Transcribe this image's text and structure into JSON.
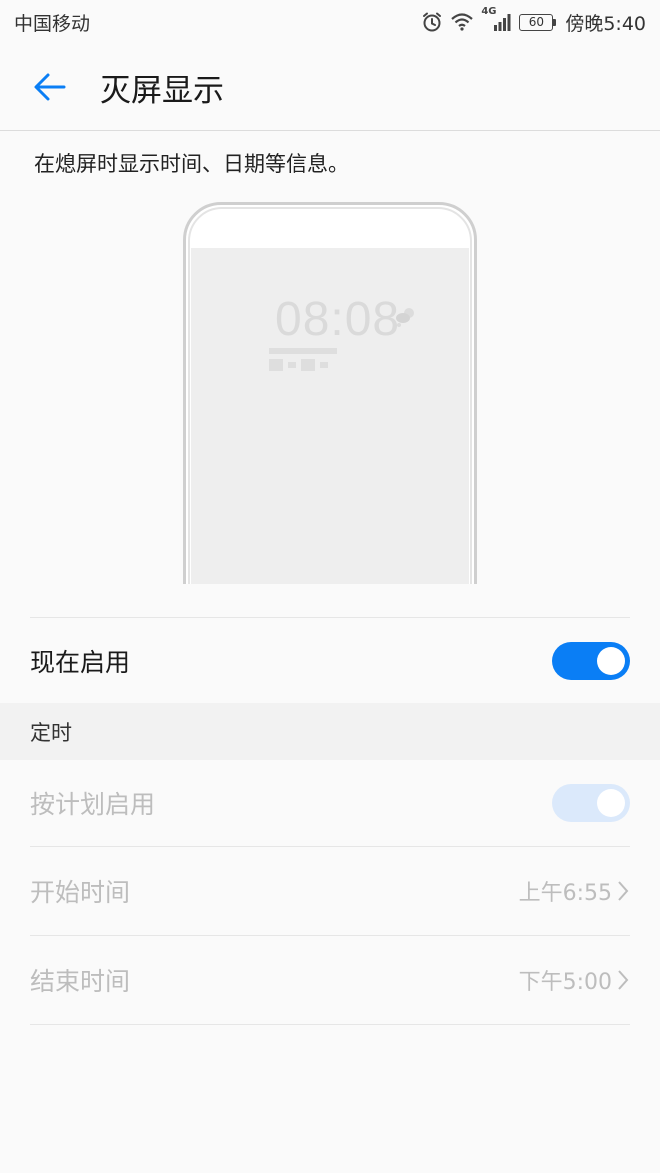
{
  "status_bar": {
    "carrier": "中国移动",
    "network": "4G",
    "battery": "60",
    "time": "傍晚5:40",
    "icons": [
      "alarm-icon",
      "wifi-icon",
      "signal-icon",
      "battery-icon"
    ]
  },
  "header": {
    "back_icon": "arrow-left-icon",
    "title": "灭屏显示"
  },
  "description": "在熄屏时显示时间、日期等信息。",
  "preview": {
    "clock": "08:08",
    "weather_icon": "cloud-sun-icon"
  },
  "enable_now": {
    "label": "现在启用",
    "on": true
  },
  "schedule_section": {
    "title": "定时",
    "scheduled": {
      "label": "按计划启用",
      "on": true,
      "enabled": false
    },
    "start": {
      "label": "开始时间",
      "value": "上午6:55"
    },
    "end": {
      "label": "结束时间",
      "value": "下午5:00"
    }
  },
  "colors": {
    "accent": "#0a7ef5",
    "accent_disabled": "#dbe9fb",
    "background": "#fafafa",
    "section_bg": "#f2f2f2",
    "disabled_text": "#bdbdbd"
  }
}
